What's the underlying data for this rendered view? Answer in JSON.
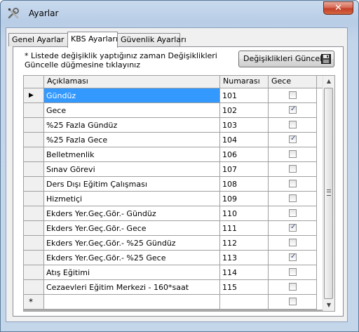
{
  "window": {
    "title": "Ayarlar",
    "close_label": "✕"
  },
  "tabs": [
    {
      "label": "Genel Ayarlar"
    },
    {
      "label": "KBS Ayarları"
    },
    {
      "label": "Güvenlik Ayarları"
    }
  ],
  "info_text": "* Listede değişiklik yaptığınız zaman Değişiklikleri Güncelle düğmesine tıklayınız",
  "update_button_label": "Değişiklikleri Güncelle",
  "grid": {
    "columns": [
      "Açıklaması",
      "Numarası",
      "Gece"
    ],
    "rows": [
      {
        "desc": "Gündüz",
        "num": "101",
        "gece": false,
        "selected": true,
        "indicator": "▶"
      },
      {
        "desc": "Gece",
        "num": "102",
        "gece": true
      },
      {
        "desc": "%25 Fazla Gündüz",
        "num": "103",
        "gece": false
      },
      {
        "desc": "%25 Fazla Gece",
        "num": "104",
        "gece": true
      },
      {
        "desc": "Belletmenlik",
        "num": "106",
        "gece": false
      },
      {
        "desc": "Sınav Görevi",
        "num": "107",
        "gece": false
      },
      {
        "desc": "Ders Dışı Eğitim Çalışması",
        "num": "108",
        "gece": false
      },
      {
        "desc": "Hizmetiçi",
        "num": "109",
        "gece": false
      },
      {
        "desc": "Ekders Yer.Geç.Gör.- Gündüz",
        "num": "110",
        "gece": false
      },
      {
        "desc": "Ekders Yer.Geç.Gör.- Gece",
        "num": "111",
        "gece": true
      },
      {
        "desc": "Ekders Yer.Geç.Gör.- %25 Gündüz",
        "num": "112",
        "gece": false
      },
      {
        "desc": "Ekders Yer.Geç.Gör.- %25 Gece",
        "num": "113",
        "gece": true
      },
      {
        "desc": "Atış Eğitimi",
        "num": "114",
        "gece": false
      },
      {
        "desc": "Cezaevleri Eğitim Merkezi - 160*saat",
        "num": "115",
        "gece": false
      },
      {
        "desc": "",
        "num": "",
        "gece": false,
        "new_row": true,
        "indicator": "*"
      }
    ]
  },
  "colors": {
    "selection": "#3399ff",
    "checkmark": "#3a4d88"
  }
}
